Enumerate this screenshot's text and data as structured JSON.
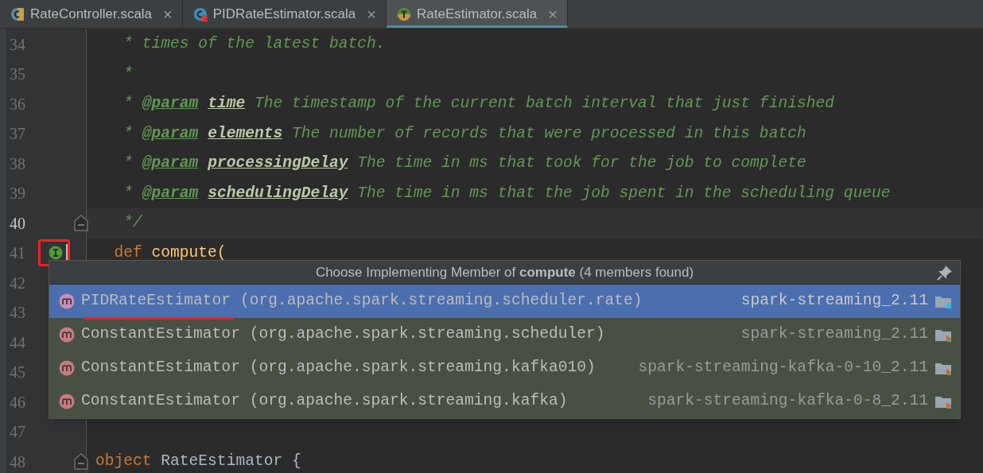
{
  "tabs": [
    {
      "label": "RateController.scala",
      "kind": "class",
      "selected": false,
      "close": "×"
    },
    {
      "label": "PIDRateEstimator.scala",
      "kind": "class-error",
      "selected": false,
      "close": "×"
    },
    {
      "label": "RateEstimator.scala",
      "kind": "trait",
      "selected": true,
      "close": "×"
    }
  ],
  "editor": {
    "lines": [
      {
        "number": "34",
        "kind": "doc",
        "text": "   * times of the latest batch."
      },
      {
        "number": "35",
        "kind": "doc",
        "text": "   *"
      },
      {
        "number": "36",
        "kind": "param",
        "lead": "   * ",
        "tag": "@param",
        "name": "time",
        "text": " The timestamp of the current batch interval that just finished"
      },
      {
        "number": "37",
        "kind": "param",
        "lead": "   * ",
        "tag": "@param",
        "name": "elements",
        "text": " The number of records that were processed in this batch"
      },
      {
        "number": "38",
        "kind": "param",
        "lead": "   * ",
        "tag": "@param",
        "name": "processingDelay",
        "text": " The time in ms that took for the job to complete"
      },
      {
        "number": "39",
        "kind": "param",
        "lead": "   * ",
        "tag": "@param",
        "name": "schedulingDelay",
        "text": " The time in ms that the job spent in the scheduling queue"
      },
      {
        "number": "40",
        "kind": "doc",
        "text": "   */",
        "current": true,
        "fold": true
      },
      {
        "number": "41",
        "kind": "code",
        "keyword": "  def",
        "text": " compute(",
        "marker": true
      },
      {
        "number": "42",
        "kind": "empty"
      },
      {
        "number": "43",
        "kind": "empty"
      },
      {
        "number": "44",
        "kind": "empty"
      },
      {
        "number": "45",
        "kind": "empty"
      },
      {
        "number": "46",
        "kind": "empty"
      },
      {
        "number": "47",
        "kind": "empty"
      },
      {
        "number": "48",
        "kind": "code",
        "keyword": "object",
        "text": " RateEstimator {",
        "fold": true
      }
    ]
  },
  "popup": {
    "title": "Choose Implementing Member of **compute** (4 members found)",
    "items": [
      {
        "name": "PIDRateEstimator",
        "package": " (org.apache.spark.streaming.scheduler.rate)",
        "module": "spark-streaming_2.11",
        "selected": true
      },
      {
        "name": "ConstantEstimator",
        "package": " (org.apache.spark.streaming.scheduler)",
        "module": "spark-streaming_2.11",
        "selected": false
      },
      {
        "name": "ConstantEstimator",
        "package": " (org.apache.spark.streaming.kafka010)",
        "module": "spark-streaming-kafka-0-10_2.11",
        "selected": false
      },
      {
        "name": "ConstantEstimator",
        "package": " (org.apache.spark.streaming.kafka)",
        "module": "spark-streaming-kafka-0-8_2.11",
        "selected": false
      }
    ]
  }
}
